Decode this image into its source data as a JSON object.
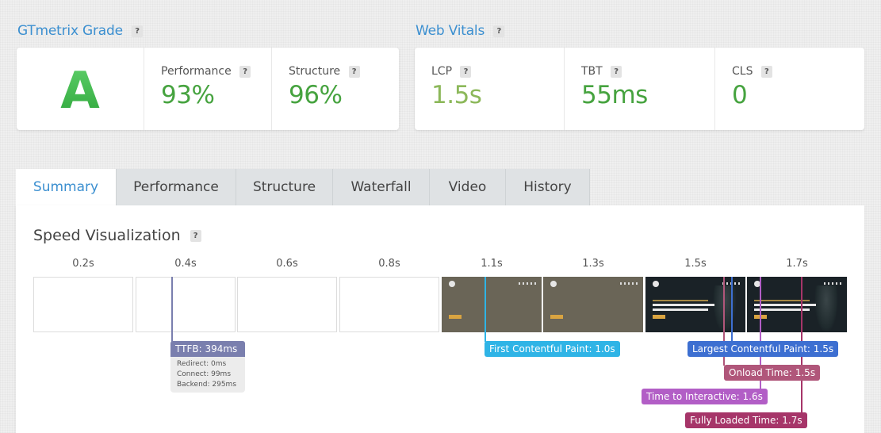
{
  "grade": {
    "title": "GTmetrix Grade",
    "letter": "A",
    "performance_label": "Performance",
    "performance_value": "93%",
    "structure_label": "Structure",
    "structure_value": "96%"
  },
  "vitals": {
    "title": "Web Vitals",
    "lcp_label": "LCP",
    "lcp_value": "1.5s",
    "tbt_label": "TBT",
    "tbt_value": "55ms",
    "cls_label": "CLS",
    "cls_value": "0"
  },
  "help_glyph": "?",
  "tabs": [
    "Summary",
    "Performance",
    "Structure",
    "Waterfall",
    "Video",
    "History"
  ],
  "speed": {
    "title": "Speed Visualization",
    "times": [
      "0.2s",
      "0.4s",
      "0.6s",
      "0.8s",
      "1.1s",
      "1.3s",
      "1.5s",
      "1.7s"
    ],
    "ttfb_label": "TTFB: 394ms",
    "ttfb_details": [
      "Redirect: 0ms",
      "Connect: 99ms",
      "Backend: 295ms"
    ],
    "fcp_label": "First Contentful Paint: 1.0s",
    "lcp_label": "Largest Contentful Paint: 1.5s",
    "onload_label": "Onload Time: 1.5s",
    "tti_label": "Time to Interactive: 1.6s",
    "fully_label": "Fully Loaded Time: 1.7s"
  },
  "colors": {
    "accent": "#3b8fd0",
    "good": "#46a33f",
    "lcp": "#8cb85a",
    "ttfb": "#7a7fae",
    "fcp": "#2fb4e6",
    "lcp_marker": "#3d6fd1",
    "onload": "#b0567a",
    "tti": "#b25ec6",
    "fully": "#a63569"
  }
}
